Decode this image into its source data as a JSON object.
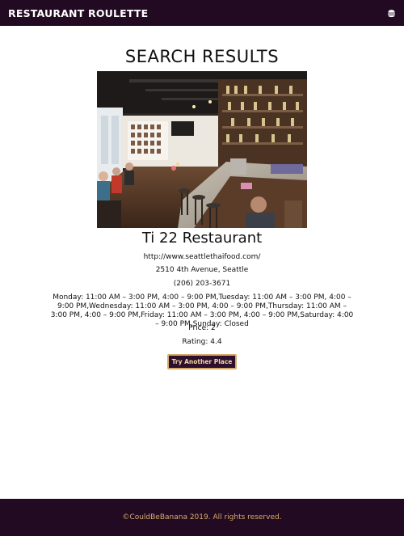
{
  "navbar": {
    "brand": "RESTAURANT ROULETTE",
    "menu_icon": "burger-icon",
    "background": "#220a22"
  },
  "main": {
    "heading": "SEARCH RESULTS",
    "photo_description_icon": "restaurant-interior-photo",
    "name": "Ti 22 Restaurant",
    "website": "http://www.seattlethaifood.com/",
    "address": "2510 4th Avenue, Seattle",
    "phone": "(206) 203-3671",
    "hours": "Monday: 11:00 AM – 3:00 PM, 4:00 – 9:00 PM,Tuesday: 11:00 AM – 3:00 PM, 4:00 – 9:00 PM,Wednesday: 11:00 AM – 3:00 PM, 4:00 – 9:00 PM,Thursday: 11:00 AM – 3:00 PM, 4:00 – 9:00 PM,Friday: 11:00 AM – 3:00 PM, 4:00 – 9:00 PM,Saturday: 4:00 – 9:00 PM,Sunday: Closed",
    "price": "Price: 2",
    "rating": "Rating: 4.4",
    "try_button": "Try Another Place"
  },
  "footer": {
    "text": "©CouldBeBanana 2019. All rights reserved.",
    "accent": "#d4ab6a"
  }
}
